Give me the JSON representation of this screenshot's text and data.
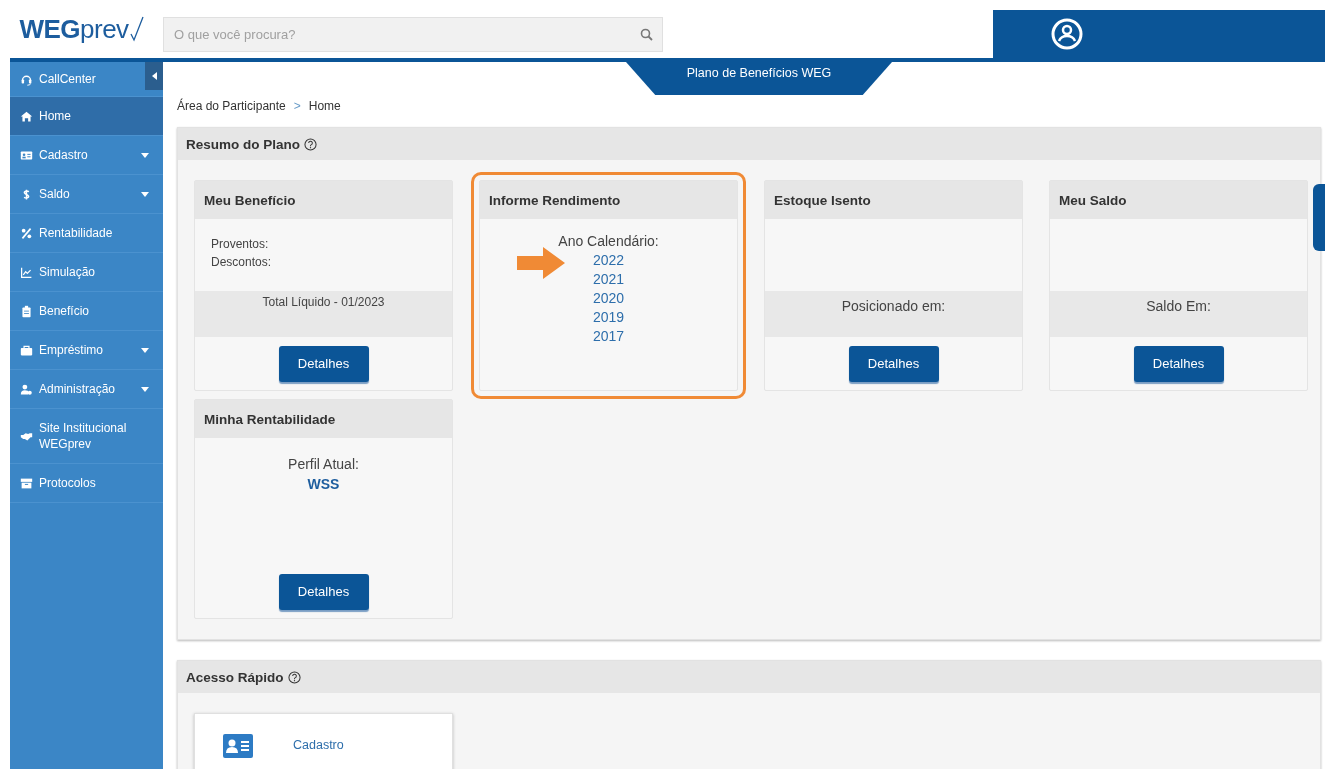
{
  "header": {
    "logo": "**WEG**prev",
    "search": {
      "placeholder": "O que você procura?"
    }
  },
  "sidebar": {
    "items": [
      {
        "label": "CallCenter",
        "selected": false,
        "expandable": false
      },
      {
        "label": "Home",
        "selected": true,
        "expandable": false
      },
      {
        "label": "Cadastro",
        "selected": false,
        "expandable": true
      },
      {
        "label": "Saldo",
        "selected": false,
        "expandable": true
      },
      {
        "label": "Rentabilidade",
        "selected": false,
        "expandable": false
      },
      {
        "label": "Simulação",
        "selected": false,
        "expandable": false
      },
      {
        "label": "Benefício",
        "selected": false,
        "expandable": false
      },
      {
        "label": "Empréstimo",
        "selected": false,
        "expandable": true
      },
      {
        "label": "Administração",
        "selected": false,
        "expandable": true
      },
      {
        "label": "Site Institucional WEGprev",
        "selected": false,
        "expandable": false
      },
      {
        "label": "Protocolos",
        "selected": false,
        "expandable": false
      }
    ]
  },
  "plan_tab": "Plano de Benefícios WEG",
  "breadcrumb": {
    "items": [
      "Área do Participante",
      "Home"
    ],
    "separator": ">"
  },
  "summary_panel": {
    "title": "Resumo do Plano",
    "cards": [
      {
        "title": "Meu Benefício",
        "highlighted": false,
        "lines": [
          "Proventos:",
          "Descontos:"
        ],
        "band": "Total Líquido - 01/2023",
        "button": "Detalhes"
      },
      {
        "title": "Informe Rendimento",
        "highlighted": true,
        "label": "Ano Calendário:",
        "links": [
          "2022",
          "2021",
          "2020",
          "2019",
          "2017"
        ]
      },
      {
        "title": "Estoque Isento",
        "highlighted": false,
        "band": "Posicionado em:",
        "button": "Detalhes"
      },
      {
        "title": "Meu Saldo",
        "highlighted": false,
        "band": "Saldo Em:",
        "button": "Detalhes"
      },
      {
        "title": "Minha Rentabilidade",
        "highlighted": false,
        "label": "Perfil Atual:",
        "value": "WSS",
        "button": "Detalhes"
      }
    ]
  },
  "quick_access": {
    "title": "Acesso Rápido",
    "items": [
      {
        "label": "Cadastro"
      }
    ]
  }
}
